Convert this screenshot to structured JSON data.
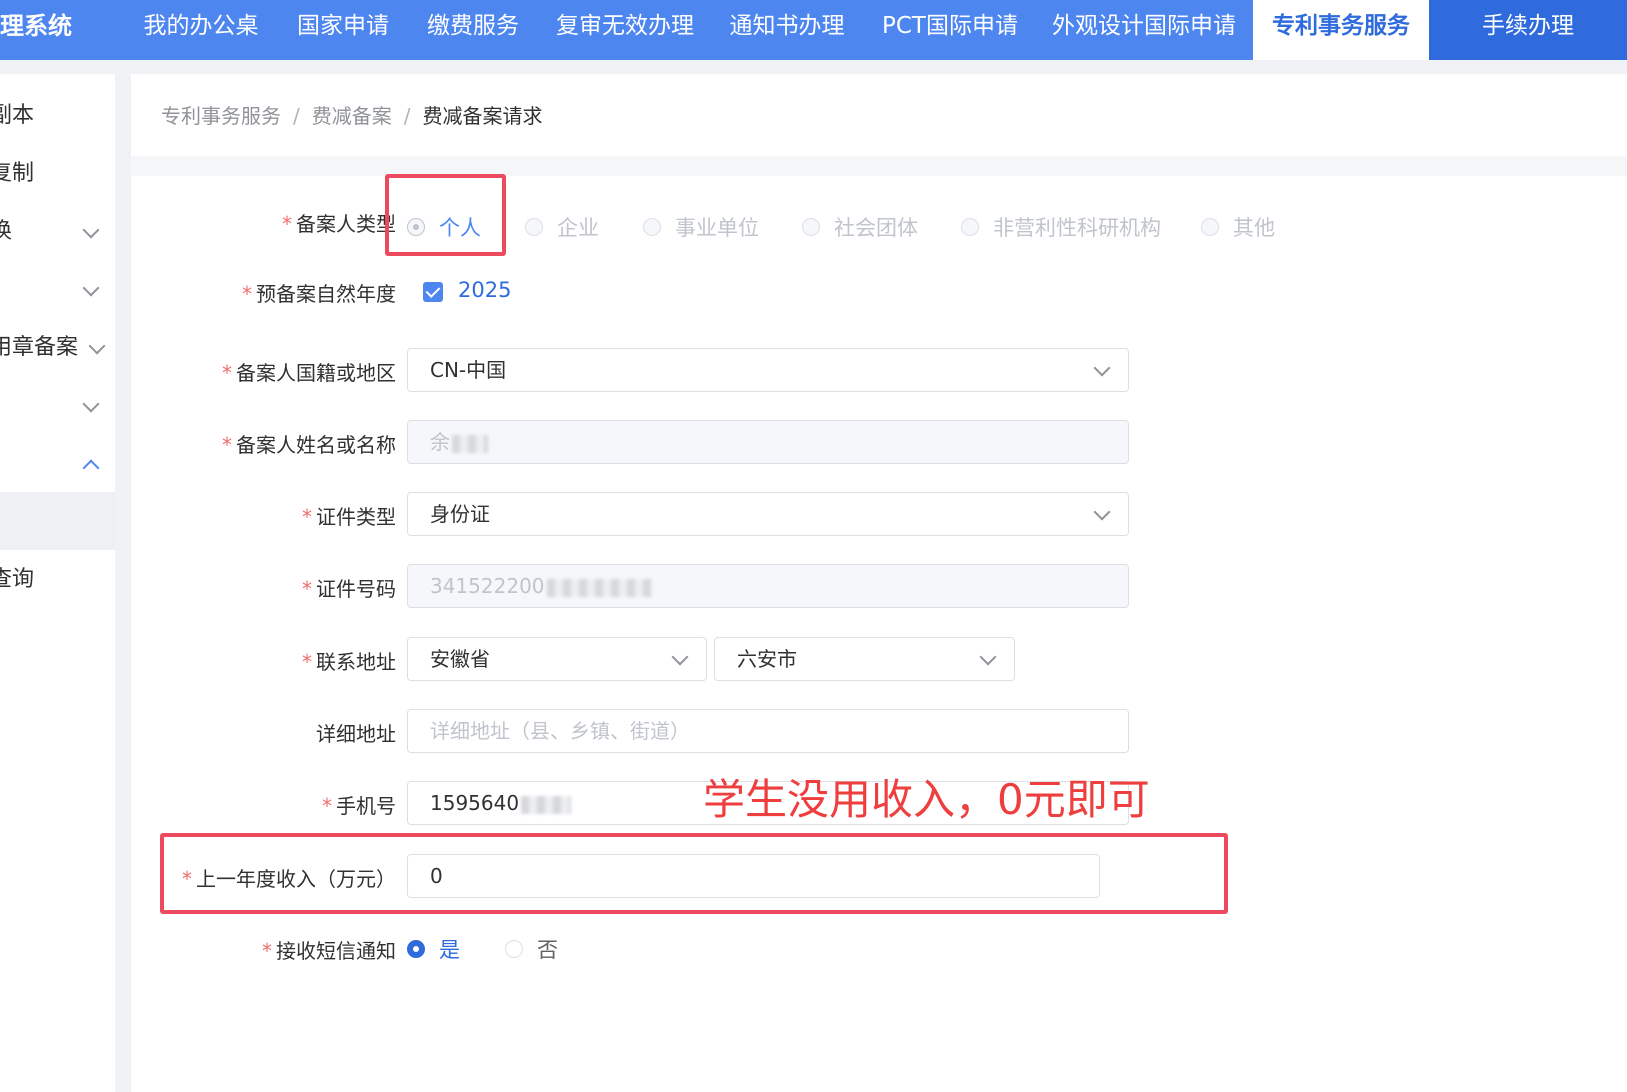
{
  "header": {
    "brand": "理系统",
    "nav": [
      "我的办公桌",
      "国家申请",
      "缴费服务",
      "复审无效办理",
      "通知书办理",
      "PCT国际申请",
      "外观设计国际申请",
      "专利事务服务",
      "手续办理"
    ]
  },
  "sidebar": {
    "items": [
      "副本",
      "复制",
      "换",
      "",
      "用章备案",
      "",
      "",
      "",
      "查询"
    ]
  },
  "breadcrumb": [
    "专利事务服务",
    "费减备案",
    "费减备案请求"
  ],
  "form": {
    "applicant_type": {
      "label": "备案人类型",
      "options": [
        "个人",
        "企业",
        "事业单位",
        "社会团体",
        "非营利性科研机构",
        "其他"
      ],
      "selected": "个人"
    },
    "year": {
      "label": "预备案自然年度",
      "value": "2025",
      "checked": true
    },
    "nationality": {
      "label": "备案人国籍或地区",
      "value": "CN-中国"
    },
    "name": {
      "label": "备案人姓名或名称",
      "value": "余"
    },
    "id_type": {
      "label": "证件类型",
      "value": "身份证"
    },
    "id_number": {
      "label": "证件号码",
      "value": "341522200"
    },
    "address": {
      "label": "联系地址",
      "province": "安徽省",
      "city": "六安市"
    },
    "detail_address": {
      "label": "详细地址",
      "placeholder": "详细地址（县、乡镇、街道）"
    },
    "phone": {
      "label": "手机号",
      "value": "1595640"
    },
    "income": {
      "label": "上一年度收入（万元）",
      "value": "0"
    },
    "sms": {
      "label": "接收短信通知",
      "options": [
        "是",
        "否"
      ],
      "selected": "是"
    }
  },
  "annotation": "学生没用收入，0元即可",
  "colors": {
    "primary": "#4e86f0",
    "required": "#f56c6c",
    "highlight": "#ee4a5f"
  }
}
